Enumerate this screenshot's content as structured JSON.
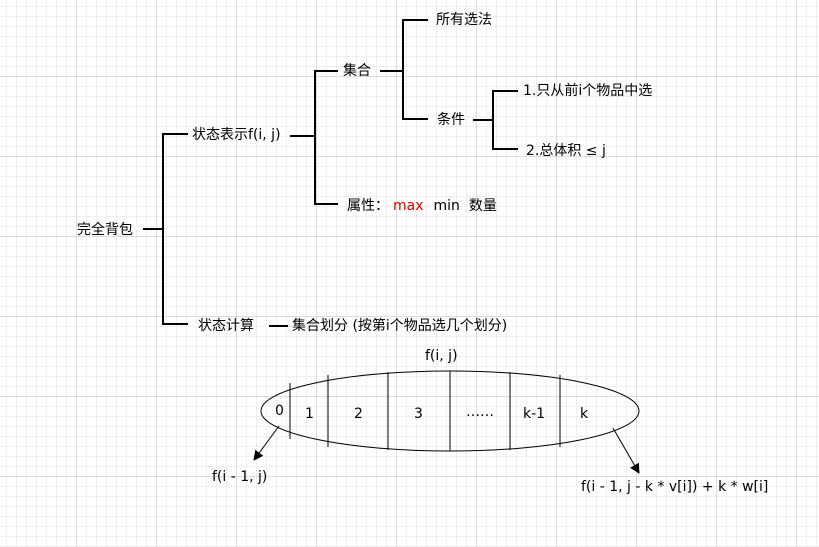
{
  "tree": {
    "root": "完全背包",
    "state_repr": "状态表示f(i, j)",
    "set": "集合",
    "all_choices": "所有选法",
    "condition": "条件",
    "cond1": "1.只从前i个物品中选",
    "cond2": "2.总体积 ≤ j",
    "attr_prefix": "属性：",
    "attr_max": "max",
    "attr_min": "min",
    "attr_count": "数量",
    "state_calc": "状态计算",
    "partition": "集合划分 (按第i个物品选几个划分)"
  },
  "ellipse": {
    "title": "f(i, j)",
    "cells": [
      "0",
      "1",
      "2",
      "3",
      "……",
      "k-1",
      "k"
    ],
    "left_result": "f(i - 1, j)",
    "right_result": "f(i - 1, j - k * v[i]) + k * w[i]"
  },
  "colors": {
    "lines": "#000000",
    "highlight": "#e00000"
  }
}
